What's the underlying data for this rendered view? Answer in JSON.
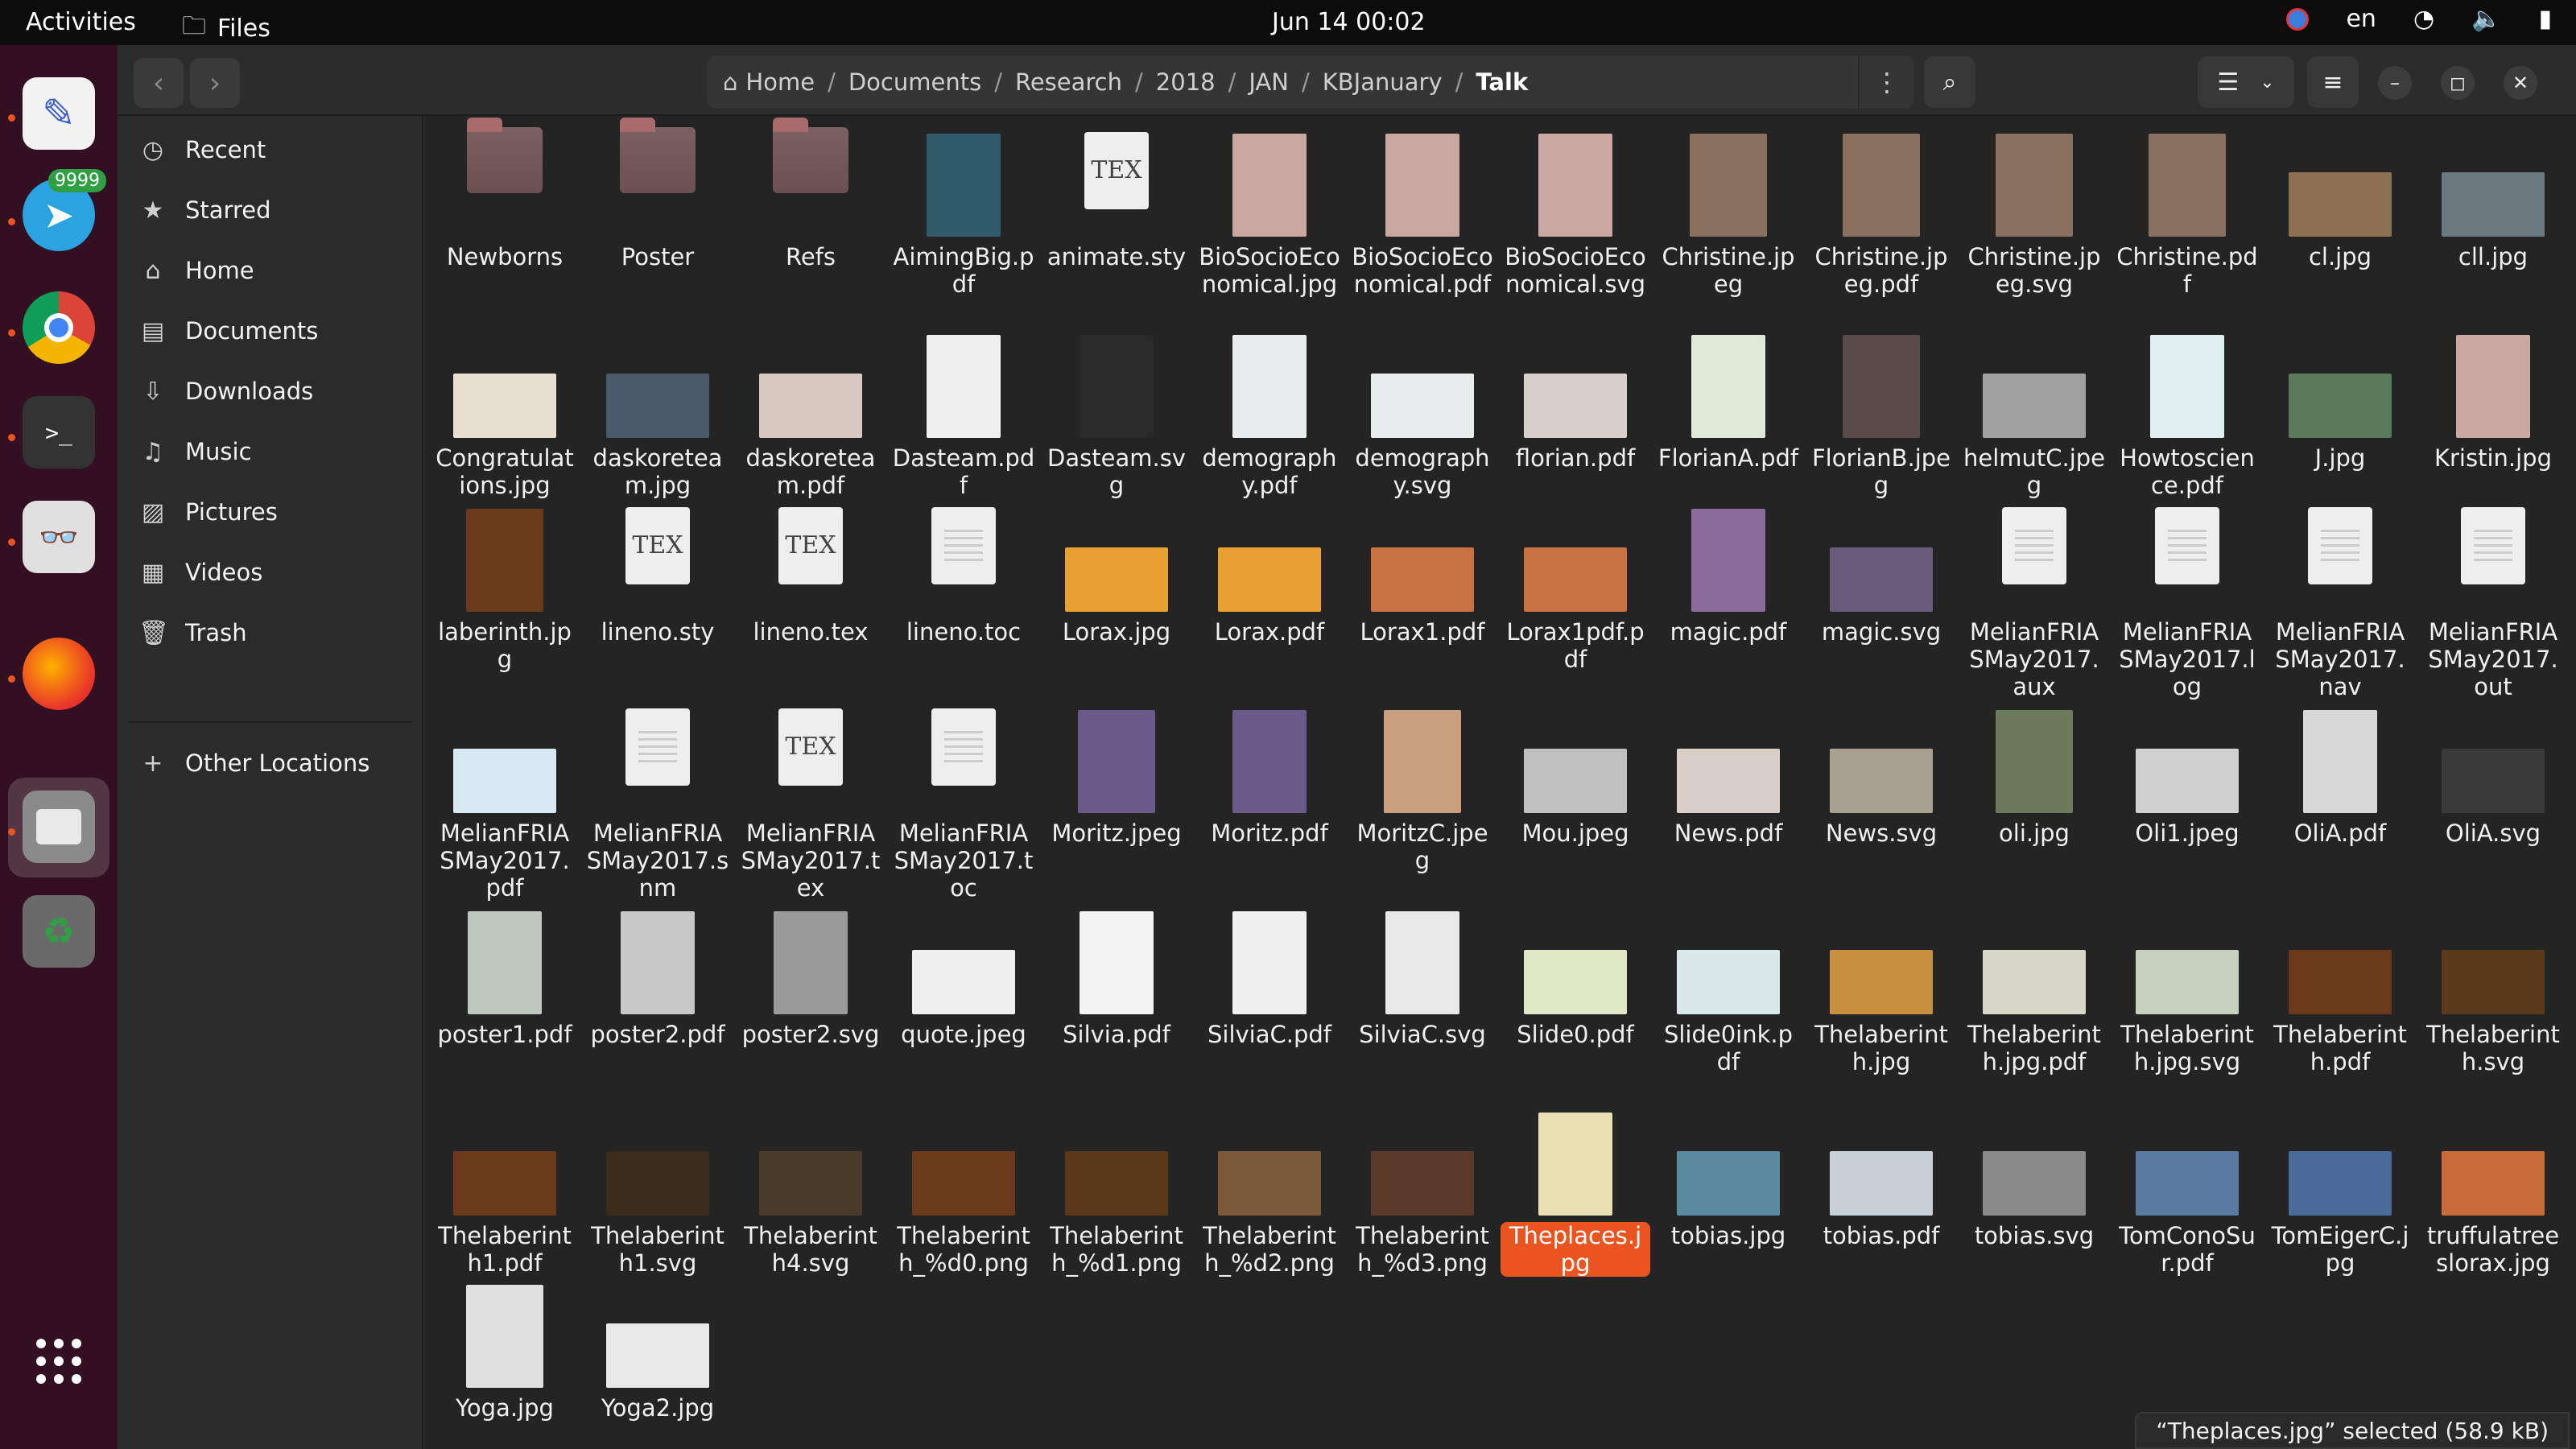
{
  "topbar": {
    "activities": "Activities",
    "app_name": "Files",
    "clock": "Jun 14  00:02",
    "lang": "en"
  },
  "dock": {
    "telegram_badge": "9999"
  },
  "path": {
    "home": "Home",
    "segments": [
      "Documents",
      "Research",
      "2018",
      "JAN",
      "KBJanuary"
    ],
    "current": "Talk"
  },
  "sidebar": {
    "items": [
      {
        "label": "Recent",
        "icon": "clock-icon"
      },
      {
        "label": "Starred",
        "icon": "star-icon"
      },
      {
        "label": "Home",
        "icon": "home-icon"
      },
      {
        "label": "Documents",
        "icon": "document-icon"
      },
      {
        "label": "Downloads",
        "icon": "download-icon"
      },
      {
        "label": "Music",
        "icon": "music-icon"
      },
      {
        "label": "Pictures",
        "icon": "picture-icon"
      },
      {
        "label": "Videos",
        "icon": "video-icon"
      },
      {
        "label": "Trash",
        "icon": "trash-icon"
      }
    ],
    "other": "Other Locations"
  },
  "files": [
    {
      "name": "Newborns",
      "kind": "folder"
    },
    {
      "name": "Poster",
      "kind": "folder"
    },
    {
      "name": "Refs",
      "kind": "folder"
    },
    {
      "name": "AimingBig.pdf",
      "kind": "page",
      "color": "#2f5a6a"
    },
    {
      "name": "animate.sty",
      "kind": "tex"
    },
    {
      "name": "BioSocioEconomical.jpg",
      "kind": "page",
      "color": "#c8a8a0"
    },
    {
      "name": "BioSocioEconomical.pdf",
      "kind": "page",
      "color": "#c8a8a0"
    },
    {
      "name": "BioSocioEconomical.svg",
      "kind": "page",
      "color": "#c8a8a0"
    },
    {
      "name": "Christine.jpeg",
      "kind": "photo",
      "color": "#8a7060"
    },
    {
      "name": "Christine.jpeg.pdf",
      "kind": "photo",
      "color": "#8a7060"
    },
    {
      "name": "Christine.jpeg.svg",
      "kind": "photo",
      "color": "#8a7060"
    },
    {
      "name": "Christine.pdf",
      "kind": "photo",
      "color": "#8a7060"
    },
    {
      "name": "cl.jpg",
      "kind": "wide",
      "color": "#8a7050"
    },
    {
      "name": "cll.jpg",
      "kind": "wide",
      "color": "#6a7a80"
    },
    {
      "name": "Congratulations.jpg",
      "kind": "wide",
      "color": "#e8e0d0"
    },
    {
      "name": "daskoreteam.jpg",
      "kind": "wide",
      "color": "#4a5a6a"
    },
    {
      "name": "daskoreteam.pdf",
      "kind": "wide",
      "color": "#d8c8c0"
    },
    {
      "name": "Dasteam.pdf",
      "kind": "page",
      "color": "#f0f0f0"
    },
    {
      "name": "Dasteam.svg",
      "kind": "page",
      "color": "#2a2a2a"
    },
    {
      "name": "demography.pdf",
      "kind": "page",
      "color": "#e8ecec"
    },
    {
      "name": "demography.svg",
      "kind": "wide",
      "color": "#e8ecec"
    },
    {
      "name": "florian.pdf",
      "kind": "wide",
      "color": "#d8d0c8"
    },
    {
      "name": "FlorianA.pdf",
      "kind": "page",
      "color": "#e0e8d8"
    },
    {
      "name": "FlorianB.jpeg",
      "kind": "photo",
      "color": "#5a4a4a"
    },
    {
      "name": "helmutC.jpeg",
      "kind": "wide",
      "color": "#a0a0a0"
    },
    {
      "name": "Howtoscience.pdf",
      "kind": "page",
      "color": "#e0f0f0"
    },
    {
      "name": "J.jpg",
      "kind": "wide",
      "color": "#5a7a5a"
    },
    {
      "name": "Kristin.jpg",
      "kind": "page",
      "color": "#c8a8a0"
    },
    {
      "name": "laberinth.jpg",
      "kind": "photo",
      "color": "#6a3a1a"
    },
    {
      "name": "lineno.sty",
      "kind": "tex"
    },
    {
      "name": "lineno.tex",
      "kind": "tex"
    },
    {
      "name": "lineno.toc",
      "kind": "doc"
    },
    {
      "name": "Lorax.jpg",
      "kind": "wide",
      "color": "#e8a030"
    },
    {
      "name": "Lorax.pdf",
      "kind": "wide",
      "color": "#e8a030"
    },
    {
      "name": "Lorax1.pdf",
      "kind": "wide",
      "color": "#c87040"
    },
    {
      "name": "Lorax1pdf.pdf",
      "kind": "wide",
      "color": "#c87040"
    },
    {
      "name": "magic.pdf",
      "kind": "page",
      "color": "#8a6a9a"
    },
    {
      "name": "magic.svg",
      "kind": "wide",
      "color": "#6a5a7a"
    },
    {
      "name": "MelianFRIASMay2017.aux",
      "kind": "doc"
    },
    {
      "name": "MelianFRIASMay2017.log",
      "kind": "doc"
    },
    {
      "name": "MelianFRIASMay2017.nav",
      "kind": "doc"
    },
    {
      "name": "MelianFRIASMay2017.out",
      "kind": "doc"
    },
    {
      "name": "MelianFRIASMay2017.pdf",
      "kind": "wide",
      "color": "#d8e8f0"
    },
    {
      "name": "MelianFRIASMay2017.snm",
      "kind": "doc"
    },
    {
      "name": "MelianFRIASMay2017.tex",
      "kind": "tex"
    },
    {
      "name": "MelianFRIASMay2017.toc",
      "kind": "doc"
    },
    {
      "name": "Moritz.jpeg",
      "kind": "photo",
      "color": "#6a5a8a"
    },
    {
      "name": "Moritz.pdf",
      "kind": "page",
      "color": "#6a5a8a"
    },
    {
      "name": "MoritzC.jpeg",
      "kind": "photo",
      "color": "#c8a080"
    },
    {
      "name": "Mou.jpeg",
      "kind": "wide",
      "color": "#c0c0c0"
    },
    {
      "name": "News.pdf",
      "kind": "wide",
      "color": "#d8d0c8"
    },
    {
      "name": "News.svg",
      "kind": "wide",
      "color": "#a8a090"
    },
    {
      "name": "oli.jpg",
      "kind": "photo",
      "color": "#6a7a5a"
    },
    {
      "name": "Oli1.jpeg",
      "kind": "wide",
      "color": "#d0d0d0"
    },
    {
      "name": "OliA.pdf",
      "kind": "page",
      "color": "#d8d8d8"
    },
    {
      "name": "OliA.svg",
      "kind": "wide",
      "color": "#3a3a3a"
    },
    {
      "name": "poster1.pdf",
      "kind": "page",
      "color": "#c0c8c0"
    },
    {
      "name": "poster2.pdf",
      "kind": "page",
      "color": "#c8c8c8"
    },
    {
      "name": "poster2.svg",
      "kind": "page",
      "color": "#9a9a9a"
    },
    {
      "name": "quote.jpeg",
      "kind": "wide",
      "color": "#f0f0f0"
    },
    {
      "name": "Silvia.pdf",
      "kind": "page",
      "color": "#f4f4f4"
    },
    {
      "name": "SilviaC.pdf",
      "kind": "page",
      "color": "#f0f0f0"
    },
    {
      "name": "SilviaC.svg",
      "kind": "page",
      "color": "#e8e8e8"
    },
    {
      "name": "Slide0.pdf",
      "kind": "wide",
      "color": "#e0e8c8"
    },
    {
      "name": "Slide0ink.pdf",
      "kind": "wide",
      "color": "#d8e8e8"
    },
    {
      "name": "Thelaberinth.jpg",
      "kind": "wide",
      "color": "#c89040"
    },
    {
      "name": "Thelaberinth.jpg.pdf",
      "kind": "wide",
      "color": "#d8d8c8"
    },
    {
      "name": "Thelaberinth.jpg.svg",
      "kind": "wide",
      "color": "#c8d0c0"
    },
    {
      "name": "Thelaberinth.pdf",
      "kind": "wide",
      "color": "#6a3a1a"
    },
    {
      "name": "Thelaberinth.svg",
      "kind": "wide",
      "color": "#5a3a1a"
    },
    {
      "name": "Thelaberinth1.pdf",
      "kind": "wide",
      "color": "#6a3a1a"
    },
    {
      "name": "Thelaberinth1.svg",
      "kind": "wide",
      "color": "#3a2a1a"
    },
    {
      "name": "Thelaberinth4.svg",
      "kind": "wide",
      "color": "#4a3a2a"
    },
    {
      "name": "Thelaberinth_%d0.png",
      "kind": "wide",
      "color": "#6a3a1a"
    },
    {
      "name": "Thelaberinth_%d1.png",
      "kind": "wide",
      "color": "#5a3a1a"
    },
    {
      "name": "Thelaberinth_%d2.png",
      "kind": "wide",
      "color": "#7a5a3a"
    },
    {
      "name": "Thelaberinth_%d3.png",
      "kind": "wide",
      "color": "#5a3a2a"
    },
    {
      "name": "Theplaces.jpg",
      "kind": "page",
      "color": "#e8e0b0",
      "selected": true
    },
    {
      "name": "tobias.jpg",
      "kind": "wide",
      "color": "#5a8aa0"
    },
    {
      "name": "tobias.pdf",
      "kind": "wide",
      "color": "#c8d0d8"
    },
    {
      "name": "tobias.svg",
      "kind": "wide",
      "color": "#8a8a8a"
    },
    {
      "name": "TomConoSur.pdf",
      "kind": "wide",
      "color": "#5a7aa0"
    },
    {
      "name": "TomEigerC.jpg",
      "kind": "wide",
      "color": "#4a6a9a"
    },
    {
      "name": "truffulatreeslorax.jpg",
      "kind": "wide",
      "color": "#c86a3a"
    },
    {
      "name": "Yoga.jpg",
      "kind": "photo",
      "color": "#e0e0e0"
    },
    {
      "name": "Yoga2.jpg",
      "kind": "wide",
      "color": "#e8e8e8"
    }
  ],
  "status": "“Theplaces.jpg” selected  (58.9 kB)"
}
